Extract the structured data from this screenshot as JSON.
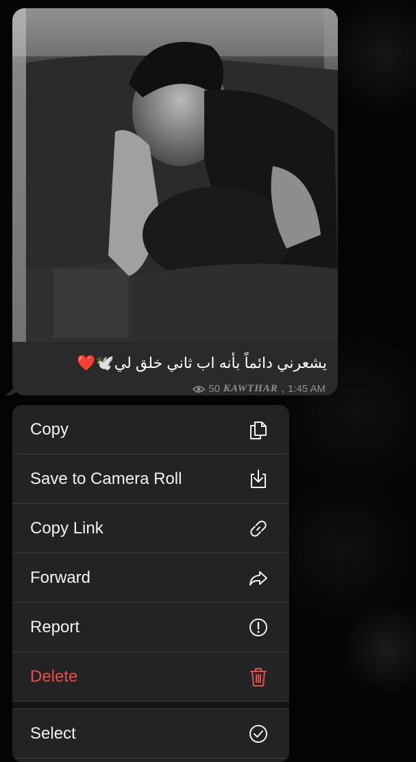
{
  "message": {
    "caption": "يشعرني دائماً بأنه اب ثاني خلق لي🕊️❤️",
    "caption_text": "يشعرني دائماً بأنه اب ثاني خلق لي",
    "caption_emoji": "🕊️",
    "caption_heart": "❤️",
    "views": "50",
    "author": "KAWTHAR",
    "time": "1:45 AM"
  },
  "menu": {
    "items": [
      {
        "label": "Copy",
        "icon": "copy-icon"
      },
      {
        "label": "Save to Camera Roll",
        "icon": "save-icon"
      },
      {
        "label": "Copy Link",
        "icon": "link-icon"
      },
      {
        "label": "Forward",
        "icon": "forward-icon"
      },
      {
        "label": "Report",
        "icon": "report-icon"
      },
      {
        "label": "Delete",
        "icon": "trash-icon"
      },
      {
        "label": "Select",
        "icon": "check-circle-icon"
      }
    ]
  },
  "colors": {
    "bubble": "#2a2a2c",
    "menu": "#232325",
    "danger": "#e5504a",
    "meta": "#8e8e93"
  }
}
